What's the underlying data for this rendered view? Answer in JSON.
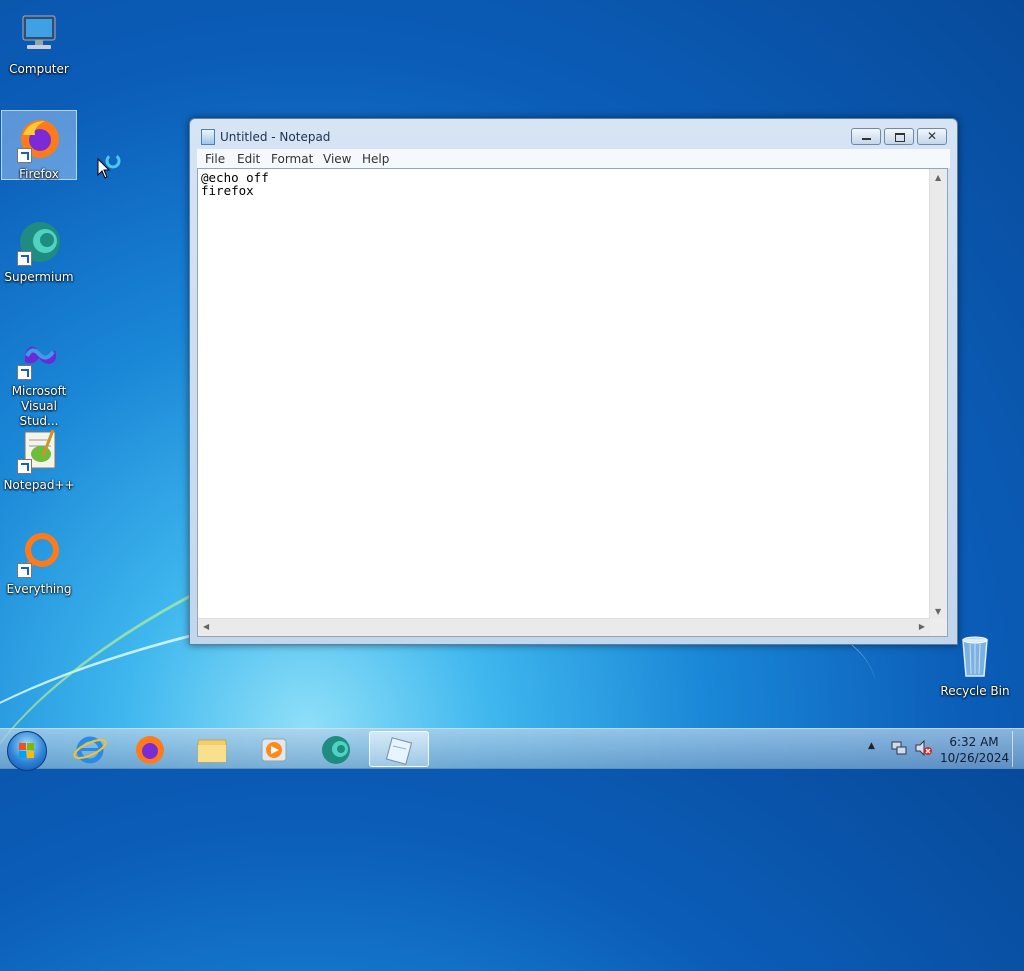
{
  "desktop": {
    "icons": [
      {
        "label": "Computer",
        "icon": "computer-icon"
      },
      {
        "label": "Firefox",
        "icon": "firefox-icon"
      },
      {
        "label": "Supermium",
        "icon": "supermium-icon"
      },
      {
        "label": "Microsoft Visual Stud...",
        "icon": "visual-studio-icon"
      },
      {
        "label": "Notepad++",
        "icon": "notepadpp-icon"
      },
      {
        "label": "Everything",
        "icon": "everything-icon"
      },
      {
        "label": "Recycle Bin",
        "icon": "recycle-bin-icon"
      }
    ],
    "selected": "Firefox"
  },
  "notepad": {
    "title": "Untitled - Notepad",
    "menu": [
      "File",
      "Edit",
      "Format",
      "View",
      "Help"
    ],
    "content": "@echo off\nfirefox"
  },
  "taskbar": {
    "items": [
      {
        "name": "internet-explorer",
        "icon": "ie-icon"
      },
      {
        "name": "firefox",
        "icon": "firefox-icon"
      },
      {
        "name": "file-explorer",
        "icon": "folder-icon"
      },
      {
        "name": "media-player",
        "icon": "media-player-icon"
      },
      {
        "name": "supermium",
        "icon": "supermium-icon"
      },
      {
        "name": "notepad",
        "icon": "notepad-icon",
        "active": true
      }
    ],
    "time": "6:32 AM",
    "date": "10/26/2024"
  }
}
